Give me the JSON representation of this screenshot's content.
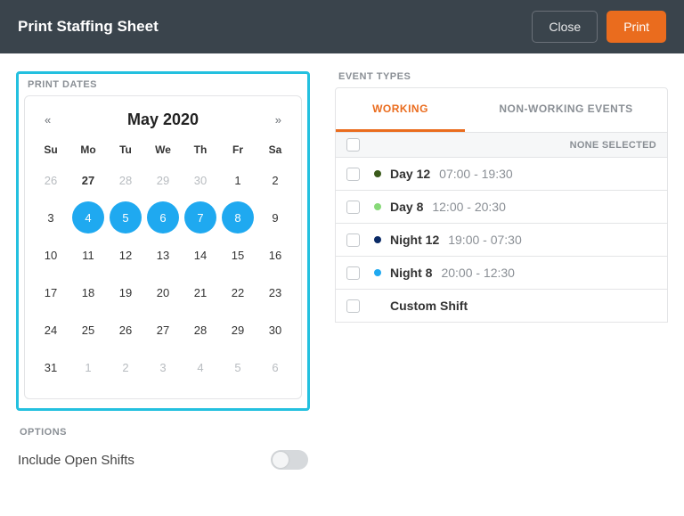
{
  "header": {
    "title": "Print Staffing Sheet",
    "close_label": "Close",
    "print_label": "Print"
  },
  "print_dates": {
    "section_label": "PRINT DATES",
    "month_title": "May 2020",
    "prev_glyph": "«",
    "next_glyph": "»",
    "weekdays": [
      "Su",
      "Mo",
      "Tu",
      "We",
      "Th",
      "Fr",
      "Sa"
    ],
    "weeks": [
      [
        {
          "n": "26",
          "muted": true
        },
        {
          "n": "27",
          "today": true
        },
        {
          "n": "28",
          "muted": true
        },
        {
          "n": "29",
          "muted": true
        },
        {
          "n": "30",
          "muted": true
        },
        {
          "n": "1"
        },
        {
          "n": "2"
        }
      ],
      [
        {
          "n": "3"
        },
        {
          "n": "4",
          "selected": true
        },
        {
          "n": "5",
          "selected": true
        },
        {
          "n": "6",
          "selected": true
        },
        {
          "n": "7",
          "selected": true
        },
        {
          "n": "8",
          "selected": true
        },
        {
          "n": "9"
        }
      ],
      [
        {
          "n": "10"
        },
        {
          "n": "11"
        },
        {
          "n": "12"
        },
        {
          "n": "13"
        },
        {
          "n": "14"
        },
        {
          "n": "15"
        },
        {
          "n": "16"
        }
      ],
      [
        {
          "n": "17"
        },
        {
          "n": "18"
        },
        {
          "n": "19"
        },
        {
          "n": "20"
        },
        {
          "n": "21"
        },
        {
          "n": "22"
        },
        {
          "n": "23"
        }
      ],
      [
        {
          "n": "24"
        },
        {
          "n": "25"
        },
        {
          "n": "26"
        },
        {
          "n": "27"
        },
        {
          "n": "28"
        },
        {
          "n": "29"
        },
        {
          "n": "30"
        }
      ],
      [
        {
          "n": "31"
        },
        {
          "n": "1",
          "muted": true
        },
        {
          "n": "2",
          "muted": true
        },
        {
          "n": "3",
          "muted": true
        },
        {
          "n": "4",
          "muted": true
        },
        {
          "n": "5",
          "muted": true
        },
        {
          "n": "6",
          "muted": true
        }
      ]
    ]
  },
  "options": {
    "section_label": "OPTIONS",
    "include_open_shifts": "Include Open Shifts"
  },
  "event_types": {
    "section_label": "EVENT TYPES",
    "tab_working": "WORKING",
    "tab_nonworking": "NON-WORKING EVENTS",
    "none_selected": "NONE SELECTED",
    "events": [
      {
        "name": "Day 12",
        "time": "07:00 - 19:30",
        "color": "#3a5a1a"
      },
      {
        "name": "Day 8",
        "time": "12:00 - 20:30",
        "color": "#87d978"
      },
      {
        "name": "Night 12",
        "time": "19:00 - 07:30",
        "color": "#0a2a66"
      },
      {
        "name": "Night 8",
        "time": "20:00 - 12:30",
        "color": "#1fa9f0"
      },
      {
        "name": "Custom Shift",
        "time": "",
        "color": "",
        "custom": true
      }
    ]
  }
}
